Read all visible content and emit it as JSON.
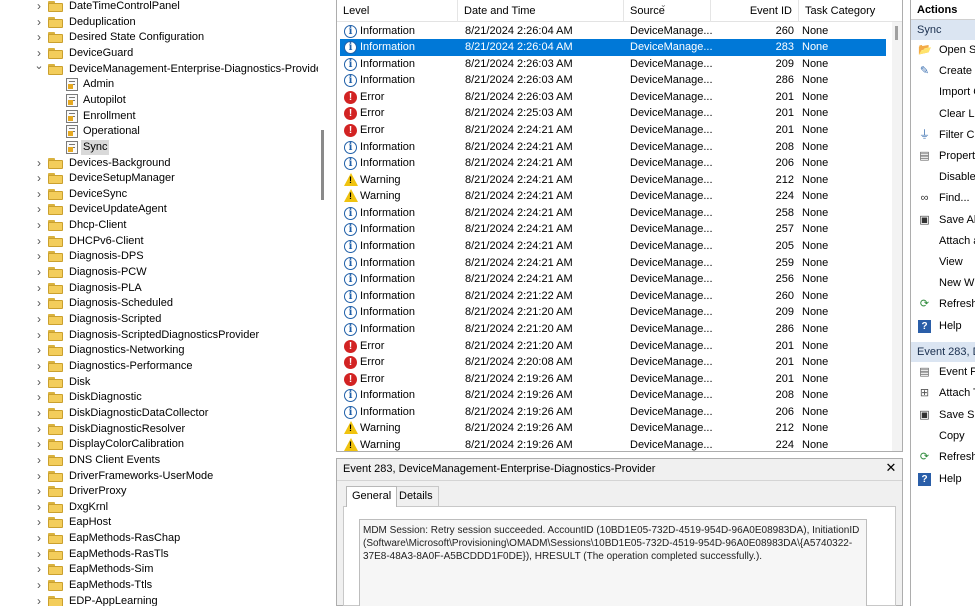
{
  "tree": {
    "items": [
      {
        "label": "DateTimeControlPanel",
        "kind": "folder",
        "expanded": false
      },
      {
        "label": "Deduplication",
        "kind": "folder",
        "expanded": false
      },
      {
        "label": "Desired State Configuration",
        "kind": "folder",
        "expanded": false
      },
      {
        "label": "DeviceGuard",
        "kind": "folder",
        "expanded": false
      },
      {
        "label": "DeviceManagement-Enterprise-Diagnostics-Provider",
        "kind": "folder",
        "expanded": true
      },
      {
        "label": "Admin",
        "kind": "log"
      },
      {
        "label": "Autopilot",
        "kind": "log"
      },
      {
        "label": "Enrollment",
        "kind": "log"
      },
      {
        "label": "Operational",
        "kind": "log"
      },
      {
        "label": "Sync",
        "kind": "log",
        "selected": true
      },
      {
        "label": "Devices-Background",
        "kind": "folder",
        "expanded": false
      },
      {
        "label": "DeviceSetupManager",
        "kind": "folder",
        "expanded": false
      },
      {
        "label": "DeviceSync",
        "kind": "folder",
        "expanded": false
      },
      {
        "label": "DeviceUpdateAgent",
        "kind": "folder",
        "expanded": false
      },
      {
        "label": "Dhcp-Client",
        "kind": "folder",
        "expanded": false
      },
      {
        "label": "DHCPv6-Client",
        "kind": "folder",
        "expanded": false
      },
      {
        "label": "Diagnosis-DPS",
        "kind": "folder",
        "expanded": false
      },
      {
        "label": "Diagnosis-PCW",
        "kind": "folder",
        "expanded": false
      },
      {
        "label": "Diagnosis-PLA",
        "kind": "folder",
        "expanded": false
      },
      {
        "label": "Diagnosis-Scheduled",
        "kind": "folder",
        "expanded": false
      },
      {
        "label": "Diagnosis-Scripted",
        "kind": "folder",
        "expanded": false
      },
      {
        "label": "Diagnosis-ScriptedDiagnosticsProvider",
        "kind": "folder",
        "expanded": false
      },
      {
        "label": "Diagnostics-Networking",
        "kind": "folder",
        "expanded": false
      },
      {
        "label": "Diagnostics-Performance",
        "kind": "folder",
        "expanded": false
      },
      {
        "label": "Disk",
        "kind": "folder",
        "expanded": false
      },
      {
        "label": "DiskDiagnostic",
        "kind": "folder",
        "expanded": false
      },
      {
        "label": "DiskDiagnosticDataCollector",
        "kind": "folder",
        "expanded": false
      },
      {
        "label": "DiskDiagnosticResolver",
        "kind": "folder",
        "expanded": false
      },
      {
        "label": "DisplayColorCalibration",
        "kind": "folder",
        "expanded": false
      },
      {
        "label": "DNS Client Events",
        "kind": "folder",
        "expanded": false
      },
      {
        "label": "DriverFrameworks-UserMode",
        "kind": "folder",
        "expanded": false
      },
      {
        "label": "DriverProxy",
        "kind": "folder",
        "expanded": false
      },
      {
        "label": "DxgKrnl",
        "kind": "folder",
        "expanded": false
      },
      {
        "label": "EapHost",
        "kind": "folder",
        "expanded": false
      },
      {
        "label": "EapMethods-RasChap",
        "kind": "folder",
        "expanded": false
      },
      {
        "label": "EapMethods-RasTls",
        "kind": "folder",
        "expanded": false
      },
      {
        "label": "EapMethods-Sim",
        "kind": "folder",
        "expanded": false
      },
      {
        "label": "EapMethods-Ttls",
        "kind": "folder",
        "expanded": false
      },
      {
        "label": "EDP-AppLearning",
        "kind": "folder",
        "expanded": false
      }
    ]
  },
  "events": {
    "columns": {
      "level": "Level",
      "date": "Date and Time",
      "source": "Source",
      "event_id": "Event ID",
      "task": "Task Category"
    },
    "rows": [
      {
        "level": "Information",
        "date": "8/21/2024 2:26:04 AM",
        "source": "DeviceManage...",
        "id": "260",
        "task": "None"
      },
      {
        "level": "Information",
        "date": "8/21/2024 2:26:04 AM",
        "source": "DeviceManage...",
        "id": "283",
        "task": "None",
        "selected": true
      },
      {
        "level": "Information",
        "date": "8/21/2024 2:26:03 AM",
        "source": "DeviceManage...",
        "id": "209",
        "task": "None"
      },
      {
        "level": "Information",
        "date": "8/21/2024 2:26:03 AM",
        "source": "DeviceManage...",
        "id": "286",
        "task": "None"
      },
      {
        "level": "Error",
        "date": "8/21/2024 2:26:03 AM",
        "source": "DeviceManage...",
        "id": "201",
        "task": "None"
      },
      {
        "level": "Error",
        "date": "8/21/2024 2:25:03 AM",
        "source": "DeviceManage...",
        "id": "201",
        "task": "None"
      },
      {
        "level": "Error",
        "date": "8/21/2024 2:24:21 AM",
        "source": "DeviceManage...",
        "id": "201",
        "task": "None"
      },
      {
        "level": "Information",
        "date": "8/21/2024 2:24:21 AM",
        "source": "DeviceManage...",
        "id": "208",
        "task": "None"
      },
      {
        "level": "Information",
        "date": "8/21/2024 2:24:21 AM",
        "source": "DeviceManage...",
        "id": "206",
        "task": "None"
      },
      {
        "level": "Warning",
        "date": "8/21/2024 2:24:21 AM",
        "source": "DeviceManage...",
        "id": "212",
        "task": "None"
      },
      {
        "level": "Warning",
        "date": "8/21/2024 2:24:21 AM",
        "source": "DeviceManage...",
        "id": "224",
        "task": "None"
      },
      {
        "level": "Information",
        "date": "8/21/2024 2:24:21 AM",
        "source": "DeviceManage...",
        "id": "258",
        "task": "None"
      },
      {
        "level": "Information",
        "date": "8/21/2024 2:24:21 AM",
        "source": "DeviceManage...",
        "id": "257",
        "task": "None"
      },
      {
        "level": "Information",
        "date": "8/21/2024 2:24:21 AM",
        "source": "DeviceManage...",
        "id": "205",
        "task": "None"
      },
      {
        "level": "Information",
        "date": "8/21/2024 2:24:21 AM",
        "source": "DeviceManage...",
        "id": "259",
        "task": "None"
      },
      {
        "level": "Information",
        "date": "8/21/2024 2:24:21 AM",
        "source": "DeviceManage...",
        "id": "256",
        "task": "None"
      },
      {
        "level": "Information",
        "date": "8/21/2024 2:21:22 AM",
        "source": "DeviceManage...",
        "id": "260",
        "task": "None"
      },
      {
        "level": "Information",
        "date": "8/21/2024 2:21:20 AM",
        "source": "DeviceManage...",
        "id": "209",
        "task": "None"
      },
      {
        "level": "Information",
        "date": "8/21/2024 2:21:20 AM",
        "source": "DeviceManage...",
        "id": "286",
        "task": "None"
      },
      {
        "level": "Error",
        "date": "8/21/2024 2:21:20 AM",
        "source": "DeviceManage...",
        "id": "201",
        "task": "None"
      },
      {
        "level": "Error",
        "date": "8/21/2024 2:20:08 AM",
        "source": "DeviceManage...",
        "id": "201",
        "task": "None"
      },
      {
        "level": "Error",
        "date": "8/21/2024 2:19:26 AM",
        "source": "DeviceManage...",
        "id": "201",
        "task": "None"
      },
      {
        "level": "Information",
        "date": "8/21/2024 2:19:26 AM",
        "source": "DeviceManage...",
        "id": "208",
        "task": "None"
      },
      {
        "level": "Information",
        "date": "8/21/2024 2:19:26 AM",
        "source": "DeviceManage...",
        "id": "206",
        "task": "None"
      },
      {
        "level": "Warning",
        "date": "8/21/2024 2:19:26 AM",
        "source": "DeviceManage...",
        "id": "212",
        "task": "None"
      },
      {
        "level": "Warning",
        "date": "8/21/2024 2:19:26 AM",
        "source": "DeviceManage...",
        "id": "224",
        "task": "None"
      }
    ]
  },
  "detail": {
    "title": "Event 283, DeviceManagement-Enterprise-Diagnostics-Provider",
    "close_glyph": "✕",
    "tabs": {
      "general": "General",
      "details": "Details"
    },
    "message": "MDM Session: Retry session succeeded. AccountID (10BD1E05-732D-4519-954D-96A0E08983DA), InitiationID (Software\\Microsoft\\Provisioning\\OMADM\\Sessions\\10BD1E05-732D-4519-954D-96A0E08983DA\\{A5740322-37E8-48A3-8A0F-A5BCDDD1F0DE}), HRESULT (The operation completed successfully.)."
  },
  "actions": {
    "header": "Actions",
    "section1": "Sync",
    "section1_items": [
      {
        "label": "Open Sa",
        "icon": "folder-open-icon"
      },
      {
        "label": "Create C",
        "icon": "create-view-icon"
      },
      {
        "label": "Import C",
        "icon": ""
      },
      {
        "label": "Clear Lo",
        "icon": ""
      },
      {
        "label": "Filter Cu",
        "icon": "filter-icon"
      },
      {
        "label": "Properti",
        "icon": "properties-icon"
      },
      {
        "label": "Disable",
        "icon": ""
      },
      {
        "label": "Find...",
        "icon": "binoculars-icon"
      },
      {
        "label": "Save All",
        "icon": "save-icon"
      },
      {
        "label": "Attach a",
        "icon": ""
      },
      {
        "label": "View",
        "icon": ""
      },
      {
        "label": "New Wi",
        "icon": ""
      },
      {
        "label": "Refresh",
        "icon": "refresh-icon"
      },
      {
        "label": "Help",
        "icon": "help-icon"
      }
    ],
    "section2": "Event 283, De",
    "section2_items": [
      {
        "label": "Event Pr",
        "icon": "event-properties-icon"
      },
      {
        "label": "Attach T",
        "icon": "attach-task-icon"
      },
      {
        "label": "Save Sel",
        "icon": "save-icon"
      },
      {
        "label": "Copy",
        "icon": ""
      },
      {
        "label": "Refresh",
        "icon": "refresh-icon"
      },
      {
        "label": "Help",
        "icon": "help-icon"
      }
    ]
  },
  "colors": {
    "selection": "#0078d7",
    "section_header": "#dbe5f2",
    "error": "#d22323",
    "warning": "#f0c30f",
    "info": "#1f5fa8"
  }
}
